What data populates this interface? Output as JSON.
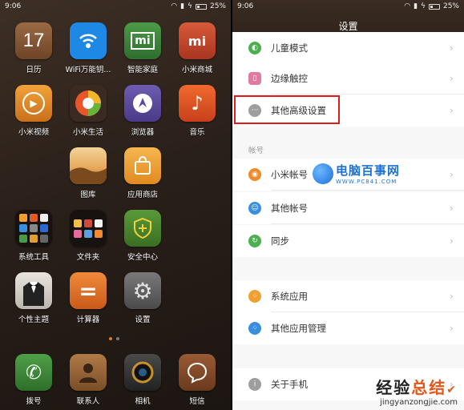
{
  "home": {
    "status": {
      "time": "9:06",
      "battery": "25%"
    },
    "apps": [
      {
        "id": "calendar",
        "label": "日历",
        "glyph": "17",
        "color": "#7a4e2e"
      },
      {
        "id": "wifi-key",
        "label": "WiFi万能钥...",
        "glyph": "",
        "color": "#1e88e5"
      },
      {
        "id": "smart-home",
        "label": "智能家庭",
        "glyph": "mi",
        "color": "#3a7d3a"
      },
      {
        "id": "mi-store",
        "label": "小米商城",
        "glyph": "mi",
        "color": "#c8462a"
      },
      {
        "id": "mi-video",
        "label": "小米视频",
        "glyph": "▶",
        "color": "#e8901e"
      },
      {
        "id": "mi-life",
        "label": "小米生活",
        "glyph": "",
        "color": "#b23a1a"
      },
      {
        "id": "browser",
        "label": "浏览器",
        "glyph": "",
        "color": "#5b4a9a"
      },
      {
        "id": "music",
        "label": "音乐",
        "glyph": "♪",
        "color": "#e0501e"
      },
      {
        "id": "gallery",
        "label": "图库",
        "glyph": "",
        "color": "#c98b3a"
      },
      {
        "id": "app-store",
        "label": "应用商店",
        "glyph": "",
        "color": "#f0a33a"
      },
      {
        "id": "system-tools",
        "label": "系统工具",
        "glyph": "",
        "color": "#2b2420"
      },
      {
        "id": "folder",
        "label": "文件夹",
        "glyph": "",
        "color": "#2b2420"
      },
      {
        "id": "security",
        "label": "安全中心",
        "glyph": "+",
        "color": "#4f8a2e"
      },
      {
        "id": "themes",
        "label": "个性主题",
        "glyph": "",
        "color": "#d7d2cc"
      },
      {
        "id": "calculator",
        "label": "计算器",
        "glyph": "=",
        "color": "#e0702a"
      },
      {
        "id": "settings",
        "label": "设置",
        "glyph": "⚙",
        "color": "#6a6a6a"
      },
      {
        "id": "phone",
        "label": "拨号",
        "glyph": "✆",
        "color": "#3f8a3a"
      },
      {
        "id": "contacts",
        "label": "联系人",
        "glyph": "",
        "color": "#9b6a3a"
      },
      {
        "id": "camera",
        "label": "相机",
        "glyph": "",
        "color": "#3a3a3a"
      },
      {
        "id": "messages",
        "label": "短信",
        "glyph": "",
        "color": "#8a4a2a"
      }
    ]
  },
  "settings": {
    "status": {
      "time": "9:06",
      "battery": "25%"
    },
    "title": "设置",
    "rows_top": [
      {
        "label": "儿童模式",
        "color": "#4cb050"
      },
      {
        "label": "边缘触控",
        "color": "#e07aa0"
      },
      {
        "label": "其他高级设置",
        "color": "#9e9e9e"
      }
    ],
    "section_account": "帐号",
    "rows_account": [
      {
        "label": "小米帐号",
        "color": "#f08a2a"
      },
      {
        "label": "其他帐号",
        "color": "#3a8ee0"
      },
      {
        "label": "同步",
        "color": "#4cb050"
      }
    ],
    "rows_apps": [
      {
        "label": "系统应用",
        "color": "#f0a030"
      },
      {
        "label": "其他应用管理",
        "color": "#3a8ee0"
      }
    ],
    "rows_bottom": [
      {
        "label": "关于手机",
        "color": "#9e9e9e"
      }
    ],
    "chevron": "›"
  },
  "watermarks": {
    "pc841_name": "电脑百事网",
    "pc841_url": "WWW.PC841.COM",
    "jyzj_name_1": "经验",
    "jyzj_name_2": "总结",
    "jyzj_url": "jingyanzongjie.com"
  }
}
